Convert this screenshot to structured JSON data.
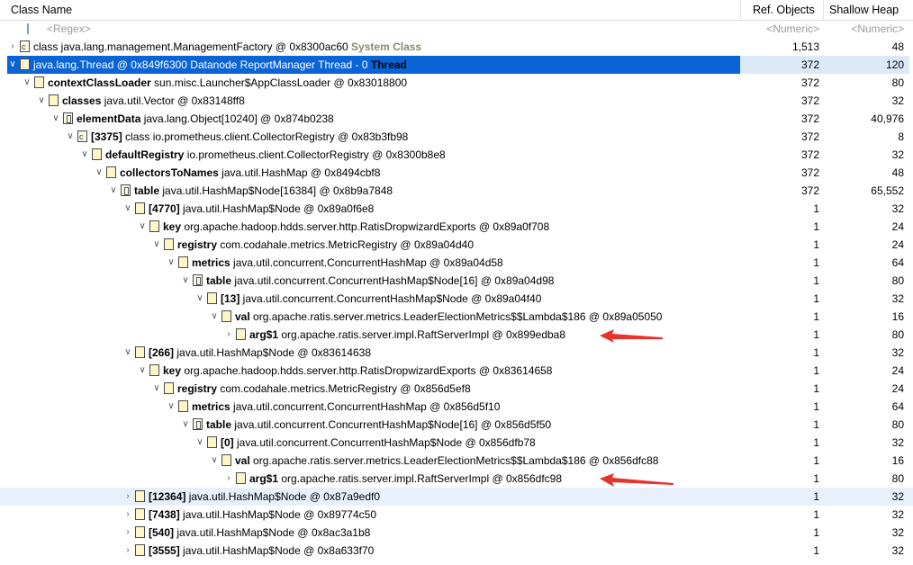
{
  "header": {
    "col_class": "Class Name",
    "col_ref": "Ref. Objects",
    "col_shallow": "Shallow Heap"
  },
  "filter": {
    "regex": "<Regex>",
    "numeric_ref": "<Numeric>",
    "numeric_shallow": "<Numeric>"
  },
  "rows": [
    {
      "name": "",
      "text": "class java.lang.management.ManagementFactory @ 0x8300ac60 ",
      "tag": "System Class",
      "ref": "1,513",
      "shallow": "48"
    },
    {
      "name": "",
      "text": "java.lang.Thread @ 0x849f6300  Datanode ReportManager Thread - 0 ",
      "tag": "Thread",
      "ref": "372",
      "shallow": "120"
    },
    {
      "name": "contextClassLoader",
      "text": " sun.misc.Launcher$AppClassLoader @ 0x83018800",
      "tag": "",
      "ref": "372",
      "shallow": "80"
    },
    {
      "name": "classes",
      "text": " java.util.Vector @ 0x83148ff8",
      "tag": "",
      "ref": "372",
      "shallow": "32"
    },
    {
      "name": "elementData",
      "text": " java.lang.Object[10240] @ 0x874b0238",
      "tag": "",
      "ref": "372",
      "shallow": "40,976"
    },
    {
      "name": "[3375]",
      "text": " class io.prometheus.client.CollectorRegistry @ 0x83b3fb98",
      "tag": "",
      "ref": "372",
      "shallow": "8"
    },
    {
      "name": "defaultRegistry",
      "text": " io.prometheus.client.CollectorRegistry @ 0x8300b8e8",
      "tag": "",
      "ref": "372",
      "shallow": "32"
    },
    {
      "name": "collectorsToNames",
      "text": " java.util.HashMap @ 0x8494cbf8",
      "tag": "",
      "ref": "372",
      "shallow": "48"
    },
    {
      "name": "table",
      "text": " java.util.HashMap$Node[16384] @ 0x8b9a7848",
      "tag": "",
      "ref": "372",
      "shallow": "65,552"
    },
    {
      "name": "[4770]",
      "text": " java.util.HashMap$Node @ 0x89a0f6e8",
      "tag": "",
      "ref": "1",
      "shallow": "32"
    },
    {
      "name": "key",
      "text": " org.apache.hadoop.hdds.server.http.RatisDropwizardExports @ 0x89a0f708",
      "tag": "",
      "ref": "1",
      "shallow": "24"
    },
    {
      "name": "registry",
      "text": " com.codahale.metrics.MetricRegistry @ 0x89a04d40",
      "tag": "",
      "ref": "1",
      "shallow": "24"
    },
    {
      "name": "metrics",
      "text": " java.util.concurrent.ConcurrentHashMap @ 0x89a04d58",
      "tag": "",
      "ref": "1",
      "shallow": "64"
    },
    {
      "name": "table",
      "text": " java.util.concurrent.ConcurrentHashMap$Node[16] @ 0x89a04d98",
      "tag": "",
      "ref": "1",
      "shallow": "80"
    },
    {
      "name": "[13]",
      "text": " java.util.concurrent.ConcurrentHashMap$Node @ 0x89a04f40",
      "tag": "",
      "ref": "1",
      "shallow": "32"
    },
    {
      "name": "val",
      "text": " org.apache.ratis.server.metrics.LeaderElectionMetrics$$Lambda$186 @ 0x89a05050",
      "tag": "",
      "ref": "1",
      "shallow": "16"
    },
    {
      "name": "arg$1",
      "text": " org.apache.ratis.server.impl.RaftServerImpl @ 0x899edba8",
      "tag": "",
      "ref": "1",
      "shallow": "80"
    },
    {
      "name": "[266]",
      "text": " java.util.HashMap$Node @ 0x83614638",
      "tag": "",
      "ref": "1",
      "shallow": "32"
    },
    {
      "name": "key",
      "text": " org.apache.hadoop.hdds.server.http.RatisDropwizardExports @ 0x83614658",
      "tag": "",
      "ref": "1",
      "shallow": "24"
    },
    {
      "name": "registry",
      "text": " com.codahale.metrics.MetricRegistry @ 0x856d5ef8",
      "tag": "",
      "ref": "1",
      "shallow": "24"
    },
    {
      "name": "metrics",
      "text": " java.util.concurrent.ConcurrentHashMap @ 0x856d5f10",
      "tag": "",
      "ref": "1",
      "shallow": "64"
    },
    {
      "name": "table",
      "text": " java.util.concurrent.ConcurrentHashMap$Node[16] @ 0x856d5f50",
      "tag": "",
      "ref": "1",
      "shallow": "80"
    },
    {
      "name": "[0]",
      "text": " java.util.concurrent.ConcurrentHashMap$Node @ 0x856dfb78",
      "tag": "",
      "ref": "1",
      "shallow": "32"
    },
    {
      "name": "val",
      "text": " org.apache.ratis.server.metrics.LeaderElectionMetrics$$Lambda$186 @ 0x856dfc88",
      "tag": "",
      "ref": "1",
      "shallow": "16"
    },
    {
      "name": "arg$1",
      "text": " org.apache.ratis.server.impl.RaftServerImpl @ 0x856dfc98",
      "tag": "",
      "ref": "1",
      "shallow": "80"
    },
    {
      "name": "[12364]",
      "text": " java.util.HashMap$Node @ 0x87a9edf0",
      "tag": "",
      "ref": "1",
      "shallow": "32"
    },
    {
      "name": "[7438]",
      "text": " java.util.HashMap$Node @ 0x89774c50",
      "tag": "",
      "ref": "1",
      "shallow": "32"
    },
    {
      "name": "[540]",
      "text": " java.util.HashMap$Node @ 0x8ac3a1b8",
      "tag": "",
      "ref": "1",
      "shallow": "32"
    },
    {
      "name": "[3555]",
      "text": " java.util.HashMap$Node @ 0x8a633f70",
      "tag": "",
      "ref": "1",
      "shallow": "32"
    }
  ],
  "colors": {
    "selection": "#0a64d6",
    "row_highlight": "#e8f1fb",
    "annotation_arrow": "#e8322b"
  }
}
